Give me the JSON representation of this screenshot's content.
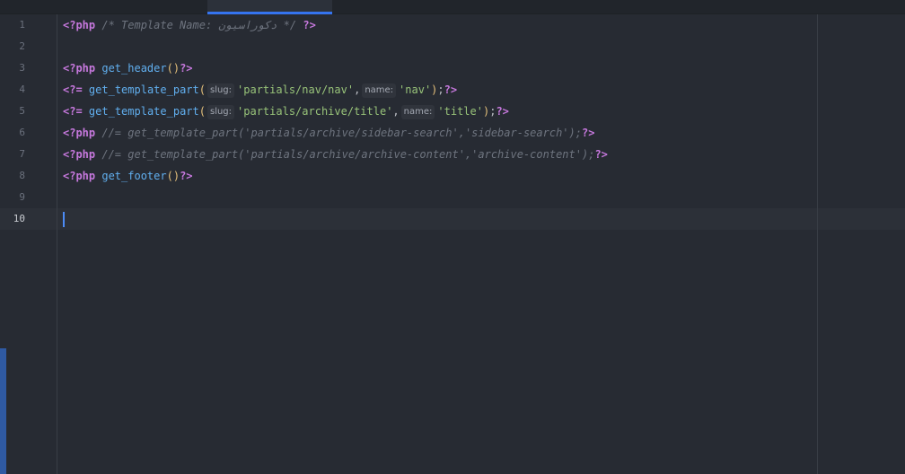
{
  "editor": {
    "line_numbers": [
      "1",
      "2",
      "3",
      "4",
      "5",
      "6",
      "7",
      "8",
      "9",
      "10"
    ],
    "current_line": "10",
    "lines": {
      "l1": {
        "open": "<?php",
        "comment": "/* Template Name: دکوراسیون */",
        "close": "?>"
      },
      "l3": {
        "open": "<?php",
        "fn": "get_header",
        "paren": "()",
        "close": "?>"
      },
      "l4": {
        "open": "<?=",
        "fn": "get_template_part",
        "lparen": "(",
        "hint1": "slug:",
        "arg1": "'partials/nav/nav'",
        "comma": ",",
        "hint2": "name:",
        "arg2": "'nav'",
        "rparen": ")",
        "semi": ";",
        "close": "?>"
      },
      "l5": {
        "open": "<?=",
        "fn": "get_template_part",
        "lparen": "(",
        "hint1": "slug:",
        "arg1": "'partials/archive/title'",
        "comma": ",",
        "hint2": "name:",
        "arg2": "'title'",
        "rparen": ")",
        "semi": ";",
        "close": "?>"
      },
      "l6": {
        "open": "<?php",
        "comment": "//= get_template_part('partials/archive/sidebar-search','sidebar-search');",
        "close": "?>"
      },
      "l7": {
        "open": "<?php",
        "comment": "//= get_template_part('partials/archive/archive-content','archive-content');",
        "close": "?>"
      },
      "l8": {
        "open": "<?php",
        "fn": "get_footer",
        "paren": "()",
        "close": "?>"
      }
    }
  },
  "colors": {
    "background": "#272b33",
    "keyword": "#c678dd",
    "function": "#61afef",
    "string": "#98c379",
    "comment": "#6e747f",
    "accent": "#3574f0"
  }
}
